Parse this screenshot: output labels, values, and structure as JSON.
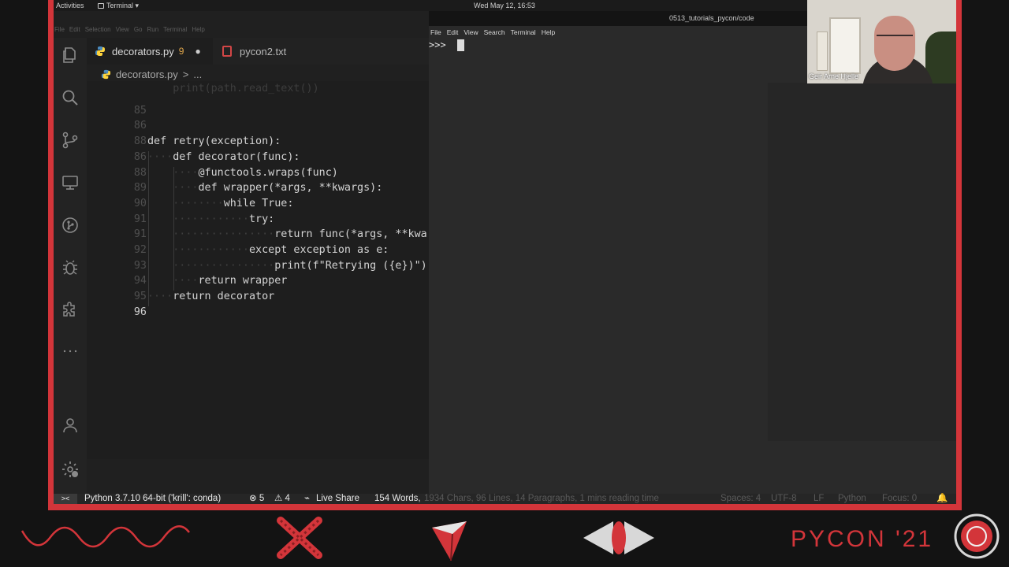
{
  "topbar": {
    "activities": "Activities",
    "app_menu": "Terminal ▾",
    "clock": "Wed May 12, 16:53"
  },
  "vscode": {
    "menu": [
      "File",
      "Edit",
      "Selection",
      "View",
      "Go",
      "Run",
      "Terminal",
      "Help"
    ],
    "tabs": [
      {
        "label": "decorators.py",
        "badge": "9",
        "modified": "●"
      },
      {
        "label": "pycon2.txt"
      }
    ],
    "breadcrumb": {
      "file": "decorators.py",
      "sep": ">",
      "rest": "..."
    },
    "code_lines": [
      {
        "num": "",
        "text": "    print(path.read_text())",
        "faded": true
      },
      {
        "num": "85",
        "text": ""
      },
      {
        "num": "86",
        "text": ""
      },
      {
        "num": "88",
        "text": "def retry(exception):"
      },
      {
        "num": "86",
        "text": "    def decorator(func):"
      },
      {
        "num": "88",
        "text": "        @functools.wraps(func)"
      },
      {
        "num": "89",
        "text": "        def wrapper(*args, **kwargs):"
      },
      {
        "num": "90",
        "text": "            while True:"
      },
      {
        "num": "91",
        "text": "                try:"
      },
      {
        "num": "91",
        "text": "                    return func(*args, **kwargs)"
      },
      {
        "num": "92",
        "text": "                except exception as e:"
      },
      {
        "num": "93",
        "text": "                    print(f\"Retrying ({e})\")"
      },
      {
        "num": "94",
        "text": "        return wrapper"
      },
      {
        "num": "95",
        "text": "    return decorator"
      },
      {
        "num": "96",
        "text": "",
        "current": true
      }
    ],
    "status": {
      "remote": "><",
      "interpreter": "Python 3.7.10 64-bit ('krill': conda)",
      "errors": "⊗ 5",
      "warnings": "⚠ 4",
      "liveshare": "Live Share",
      "words": "154 Words,",
      "chars": "1934 Chars, 96 Lines, 14 Paragraphs, 1 mins reading time",
      "spaces": "Spaces: 4",
      "encoding": "UTF-8",
      "eol": "LF",
      "language": "Python",
      "focus": "Focus: 0",
      "bell": "🔔"
    }
  },
  "terminal": {
    "title": "0513_tutorials_pycon/code",
    "menu": [
      "File",
      "Edit",
      "View",
      "Search",
      "Terminal",
      "Help"
    ],
    "prompt": ">>>"
  },
  "webcam": {
    "name": "Geir Arne Hjelle"
  },
  "footer": {
    "brand": "PYCON '21",
    "accent": "#d3353a"
  }
}
